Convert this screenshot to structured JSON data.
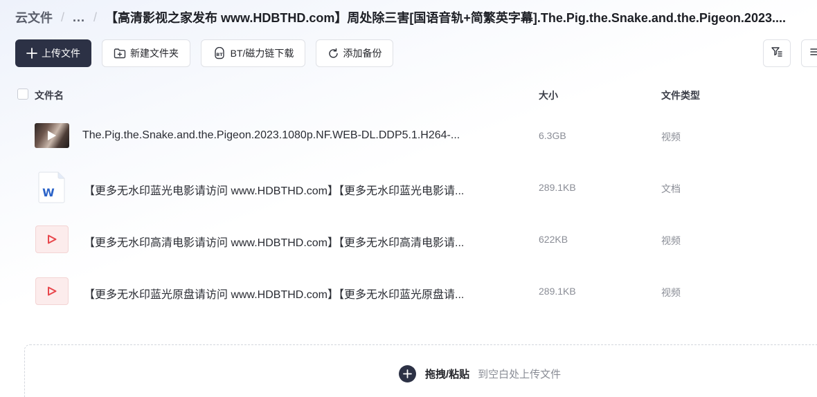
{
  "breadcrumb": {
    "root": "云文件",
    "ellipsis": "...",
    "separator": "/",
    "current": "【高清影视之家发布 www.HDBTHD.com】周处除三害[国语音轨+简繁英字幕].The.Pig.the.Snake.and.the.Pigeon.2023...."
  },
  "toolbar": {
    "upload_label": "上传文件",
    "new_folder_label": "新建文件夹",
    "bt_label": "BT/磁力链下载",
    "backup_label": "添加备份"
  },
  "table": {
    "headers": {
      "name": "文件名",
      "size": "大小",
      "type": "文件类型"
    },
    "rows": [
      {
        "icon": "video-thumbnail-icon",
        "name": "The.Pig.the.Snake.and.the.Pigeon.2023.1080p.NF.WEB-DL.DDP5.1.H264-...",
        "size": "6.3GB",
        "type": "视频"
      },
      {
        "icon": "word-document-icon",
        "name": "【更多无水印蓝光电影请访问 www.HDBTHD.com】【更多无水印蓝光电影请...",
        "size": "289.1KB",
        "type": "文档"
      },
      {
        "icon": "video-file-icon",
        "name": "【更多无水印高清电影请访问 www.HDBTHD.com】【更多无水印高清电影请...",
        "size": "622KB",
        "type": "视频"
      },
      {
        "icon": "video-file-icon",
        "name": "【更多无水印蓝光原盘请访问 www.HDBTHD.com】【更多无水印蓝光原盘请...",
        "size": "289.1KB",
        "type": "视频"
      }
    ]
  },
  "dropzone": {
    "main_label": "拖拽/粘贴",
    "hint": "到空白处上传文件"
  },
  "colors": {
    "primary": "#2c3145",
    "video_icon_red": "#e8474c",
    "word_blue": "#2b63c8"
  }
}
